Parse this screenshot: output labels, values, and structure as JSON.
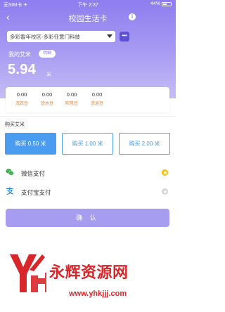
{
  "status_bar": {
    "carrier": "无SIM卡 ✦",
    "time": "下午 2:37",
    "battery": "44%"
  },
  "nav": {
    "title": "校园生活卡",
    "info_icon": "info-icon",
    "back_icon": "back-chevron-icon"
  },
  "school": {
    "selected": "多彩香年校区-多彩任意门科技",
    "more_label": "•••"
  },
  "balance": {
    "label": "我的艾米",
    "details_label": "明细",
    "value": "5.94",
    "unit": "米"
  },
  "beans": [
    {
      "value": "0.00",
      "name": "洗衣豆"
    },
    {
      "value": "0.00",
      "name": "饮水豆"
    },
    {
      "value": "0.00",
      "name": "吹风豆"
    },
    {
      "value": "0.00",
      "name": "洗浴豆"
    }
  ],
  "purchase": {
    "section_label": "购买艾米",
    "options": [
      {
        "label": "购买 0.50 米",
        "selected": true
      },
      {
        "label": "购买 1.00 米",
        "selected": false
      },
      {
        "label": "购买 2.00 米",
        "selected": false
      }
    ]
  },
  "payment": {
    "methods": [
      {
        "label": "微信支付",
        "icon": "wechat-icon",
        "selected": true
      },
      {
        "label": "支付宝支付",
        "icon": "alipay-icon",
        "selected": false
      }
    ]
  },
  "confirm_label": "确 认",
  "watermark": {
    "text": "永辉资源网",
    "url": "www.yhkjjj.com"
  },
  "colors": {
    "accent": "#8d7df0",
    "selected_blue": "#4a9cf0",
    "radio_on": "#f3c21b",
    "bean_label": "#e17a2d",
    "watermark": "#d8262b"
  }
}
